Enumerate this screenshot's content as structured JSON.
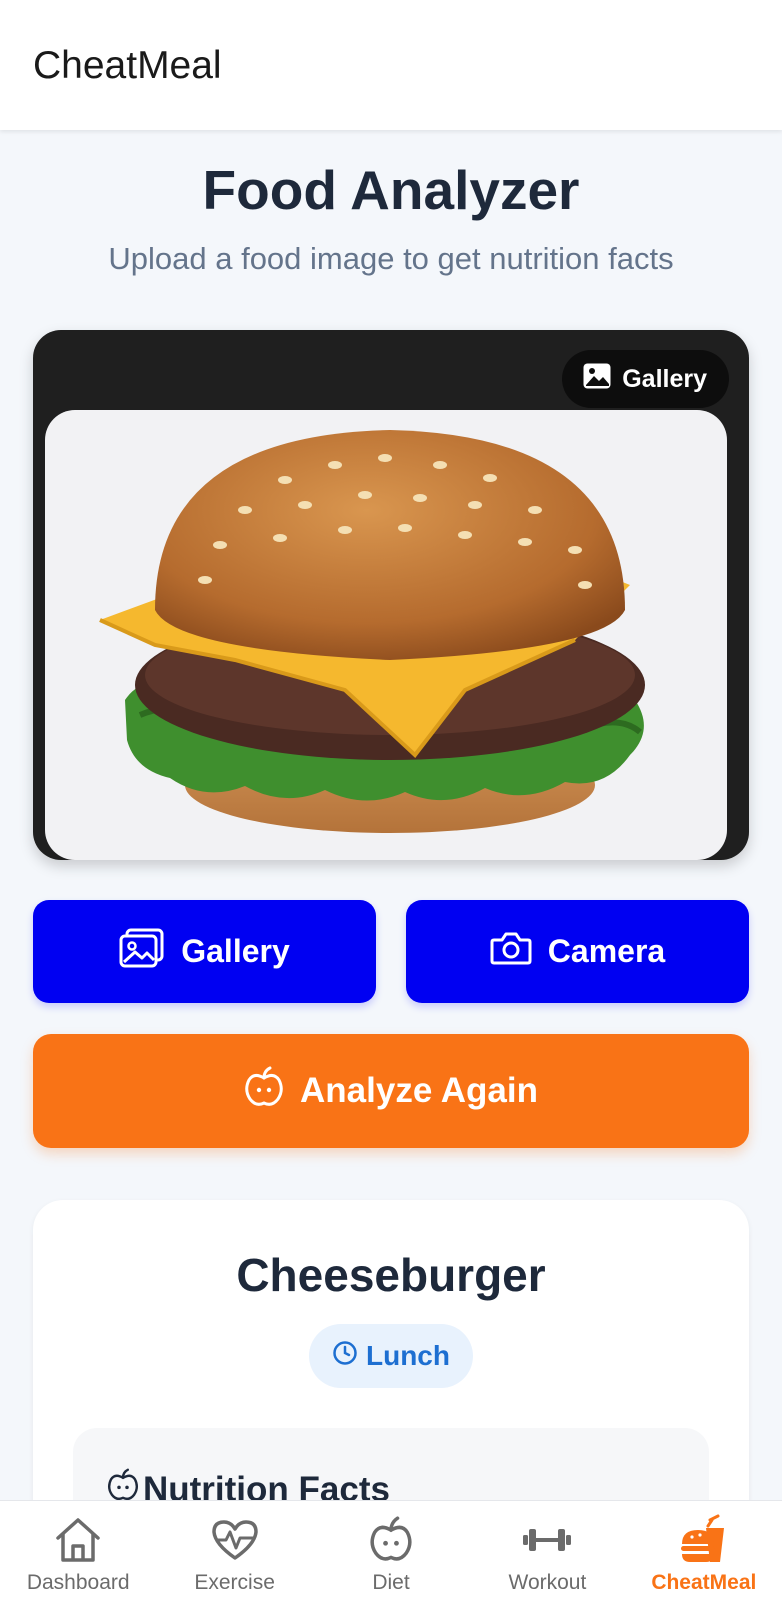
{
  "app_bar": {
    "title": "CheatMeal"
  },
  "header": {
    "title": "Food Analyzer",
    "subtitle": "Upload a food image to get nutrition facts"
  },
  "preview": {
    "chip_label": "Gallery",
    "chip_icon": "image-icon",
    "image_subject": "cheeseburger"
  },
  "actions": {
    "gallery_label": "Gallery",
    "camera_label": "Camera",
    "analyze_label": "Analyze Again"
  },
  "result": {
    "food_name": "Cheeseburger",
    "meal_type": "Lunch",
    "nutrition_title": "Nutrition Facts"
  },
  "bottom_nav": {
    "items": [
      {
        "label": "Dashboard",
        "icon": "home-icon"
      },
      {
        "label": "Exercise",
        "icon": "heart-pulse-icon"
      },
      {
        "label": "Diet",
        "icon": "apple-icon"
      },
      {
        "label": "Workout",
        "icon": "dumbbell-icon"
      },
      {
        "label": "CheatMeal",
        "icon": "burger-drink-icon",
        "active": true
      }
    ]
  },
  "colors": {
    "primary_blue": "#0000f2",
    "accent_orange": "#f97316",
    "badge_blue": "#1d6fd1",
    "text_dark": "#1e293b",
    "text_muted": "#64748b"
  }
}
